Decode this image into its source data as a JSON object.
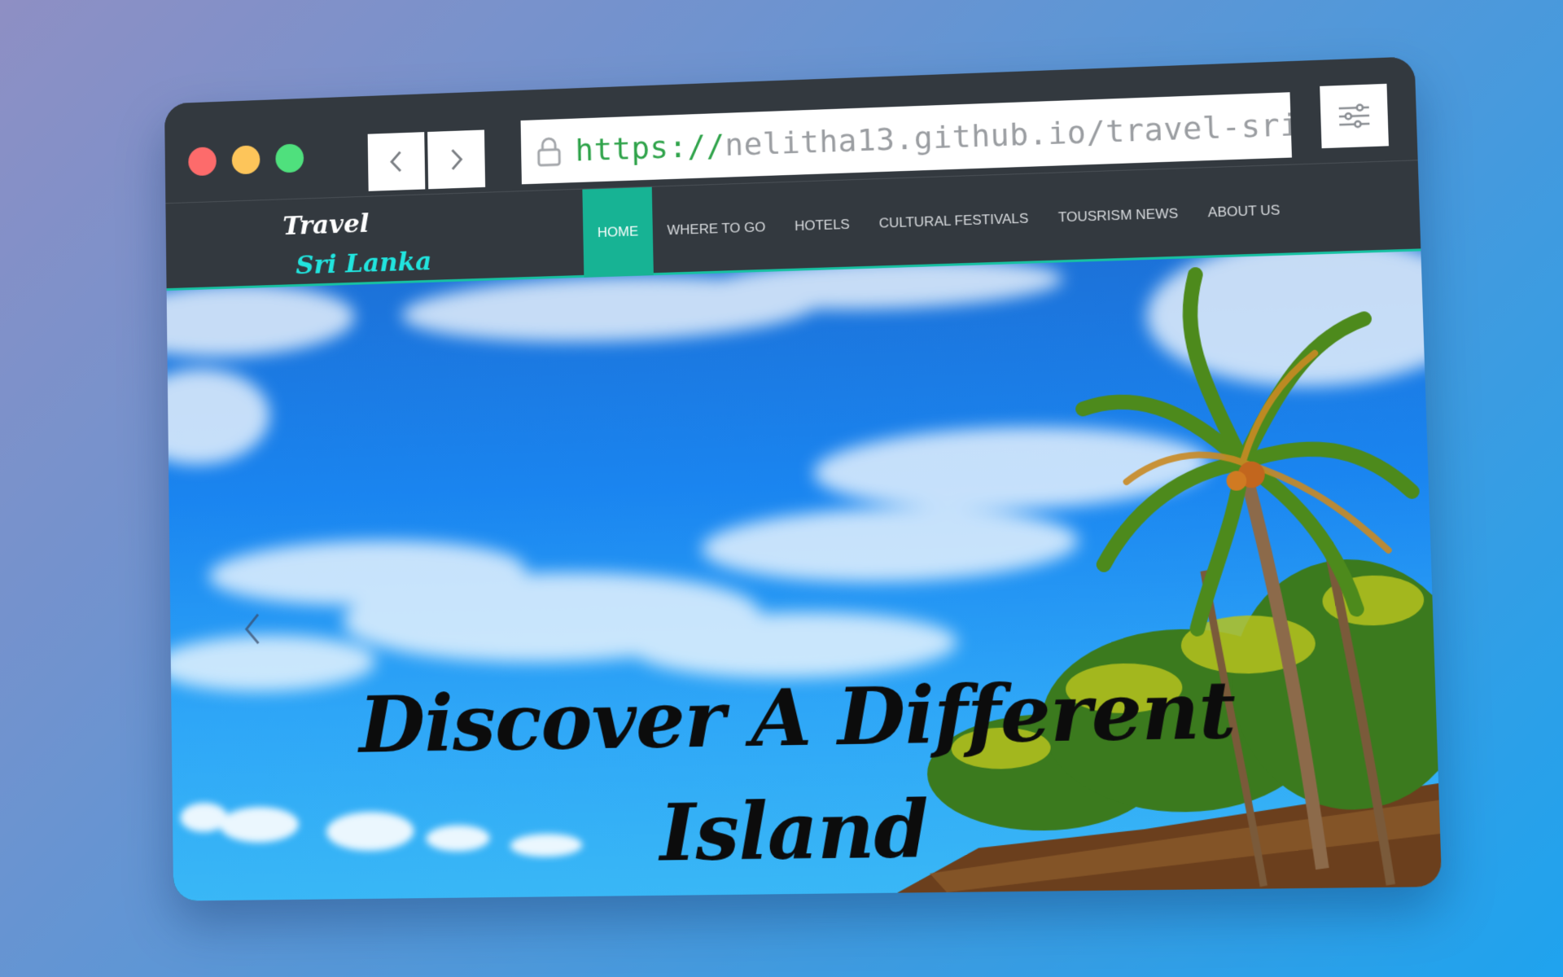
{
  "browser": {
    "url_scheme": "https://",
    "url_rest": "nelitha13.github.io/travel-sri",
    "icons": {
      "back": "chevron-left-icon",
      "forward": "chevron-right-icon",
      "lock": "lock-icon",
      "menu": "sliders-icon"
    }
  },
  "site": {
    "logo_line1": "Travel",
    "logo_line2": "Sri Lanka",
    "nav": [
      {
        "label": "HOME",
        "active": true
      },
      {
        "label": "WHERE TO GO"
      },
      {
        "label": "HOTELS"
      },
      {
        "label": "CULTURAL FESTIVALS"
      },
      {
        "label": "TOUSRISM NEWS"
      },
      {
        "label": "ABOUT US"
      }
    ],
    "accent": "#17b394",
    "logo_accent": "#21e4de"
  },
  "hero": {
    "headline_line1": "Discover A Different",
    "headline_line2": "Island"
  }
}
